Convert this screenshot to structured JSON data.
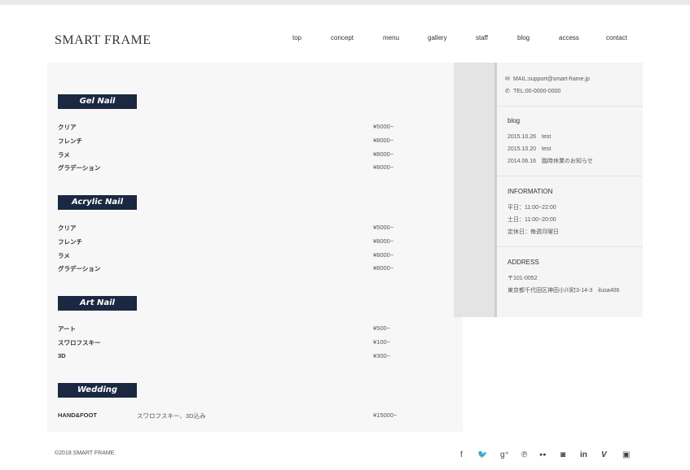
{
  "site": {
    "logo": "SMART FRAME"
  },
  "nav": [
    "top",
    "concept",
    "menu",
    "gallery",
    "staff",
    "blog",
    "access",
    "contact"
  ],
  "menu": [
    {
      "title": "Gel Nail",
      "items": [
        {
          "name": "クリア",
          "price": "¥5000~"
        },
        {
          "name": "フレンチ",
          "price": "¥8000~"
        },
        {
          "name": "ラメ",
          "price": "¥8000~"
        },
        {
          "name": "グラデーション",
          "price": "¥8000~"
        }
      ]
    },
    {
      "title": "Acrylic Nail",
      "items": [
        {
          "name": "クリア",
          "price": "¥5000~"
        },
        {
          "name": "フレンチ",
          "price": "¥8000~"
        },
        {
          "name": "ラメ",
          "price": "¥8000~"
        },
        {
          "name": "グラデーション",
          "price": "¥8000~"
        }
      ]
    },
    {
      "title": "Art Nail",
      "items": [
        {
          "name": "アート",
          "price": "¥500~"
        },
        {
          "name": "スワロフスキー",
          "price": "¥100~"
        },
        {
          "name": "3D",
          "price": "¥300~"
        }
      ]
    },
    {
      "title": "Wedding",
      "items": [
        {
          "name": "HAND&FOOT",
          "desc": "スワロフスキー、3D込み",
          "price": "¥15000~"
        }
      ]
    }
  ],
  "sidebar": {
    "mail": "MAIL:support@smart-frame.jp",
    "tel": "TEL:00-0000-0000",
    "mail_icon": "envelope-icon",
    "tel_icon": "phone-icon",
    "blog": {
      "title": "blog",
      "entries": [
        "2015.10.26　test",
        "2015.10.20　test",
        "2014.06.16　臨時休業のお知らせ"
      ]
    },
    "info": {
      "title": "INFORMATION",
      "lines": [
        "平日：11:00~22:00",
        "土日：11:00~20:00",
        "定休日：毎週月曜日"
      ]
    },
    "address": {
      "title": "ADDRESS",
      "lines": [
        "〒101-0052",
        "東京都千代田区神田小川町3-14-3　ilusa406"
      ]
    }
  },
  "footer": {
    "copyright": "©2018 SMART FRAME.",
    "social": [
      {
        "icon": "facebook-icon",
        "glyph": "f"
      },
      {
        "icon": "twitter-icon",
        "glyph": "🐦"
      },
      {
        "icon": "google-plus-icon",
        "glyph": "g⁺"
      },
      {
        "icon": "pinterest-icon",
        "glyph": "℗"
      },
      {
        "icon": "flickr-icon",
        "glyph": "●●"
      },
      {
        "icon": "instagram-icon",
        "glyph": "◙"
      },
      {
        "icon": "linkedin-icon",
        "glyph": "in"
      },
      {
        "icon": "vimeo-icon",
        "glyph": "V"
      },
      {
        "icon": "youtube-icon",
        "glyph": "▣"
      }
    ]
  }
}
